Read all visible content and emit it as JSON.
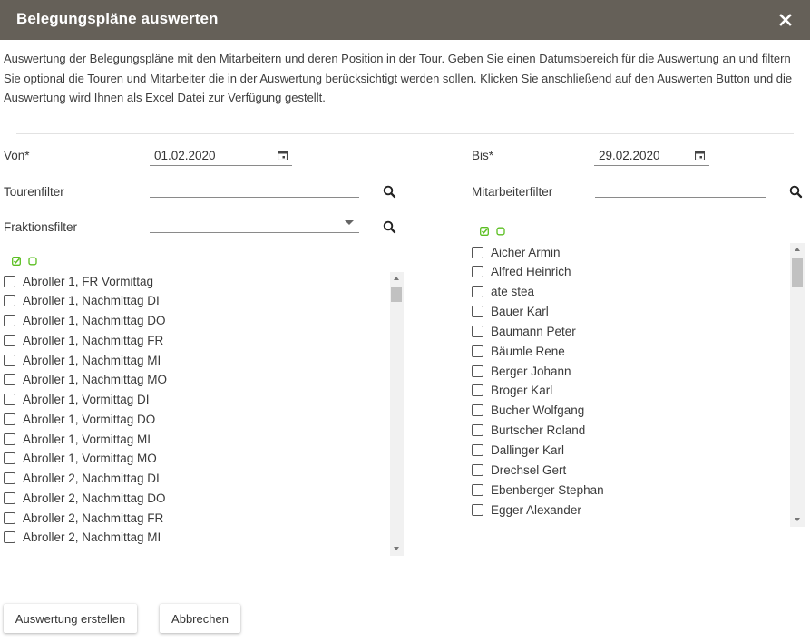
{
  "dialog": {
    "title": "Belegungspläne auswerten",
    "close_symbol": "✕",
    "intro": "Auswertung der Belegungspläne mit den Mitarbeitern und deren Position in der Tour. Geben Sie einen Datumsbereich für die Auswertung an und filtern Sie optional die Touren und Mitarbeiter die in der Auswertung berücksichtigt werden sollen. Klicken Sie anschließend auf den Auswerten Button und die Auswertung wird Ihnen als Excel Datei zur Verfügung gestellt."
  },
  "form": {
    "von_label": "Von*",
    "von_value": "01.02.2020",
    "bis_label": "Bis*",
    "bis_value": "29.02.2020",
    "tourenfilter_label": "Tourenfilter",
    "tourenfilter_value": "",
    "mitarbeiterfilter_label": "Mitarbeiterfilter",
    "mitarbeiterfilter_value": "",
    "fraktionsfilter_label": "Fraktionsfilter",
    "fraktionsfilter_value": ""
  },
  "touren_list": [
    "Abroller 1, FR Vormittag",
    "Abroller 1, Nachmittag DI",
    "Abroller 1, Nachmittag DO",
    "Abroller 1, Nachmittag FR",
    "Abroller 1, Nachmittag MI",
    "Abroller 1, Nachmittag MO",
    "Abroller 1, Vormittag DI",
    "Abroller 1, Vormittag DO",
    "Abroller 1, Vormittag MI",
    "Abroller 1, Vormittag MO",
    "Abroller 2, Nachmittag DI",
    "Abroller 2, Nachmittag DO",
    "Abroller 2, Nachmittag FR",
    "Abroller 2, Nachmittag MI"
  ],
  "mitarbeiter_list": [
    "Aicher Armin",
    "Alfred Heinrich",
    "ate stea",
    "Bauer Karl",
    "Baumann Peter",
    "Bäumle Rene",
    "Berger Johann",
    "Broger Karl",
    "Bucher Wolfgang",
    "Burtscher Roland",
    "Dallinger Karl",
    "Drechsel Gert",
    "Ebenberger Stephan",
    "Egger Alexander"
  ],
  "buttons": {
    "create": "Auswertung erstellen",
    "cancel": "Abbrechen"
  },
  "colors": {
    "titlebar": "#656058",
    "select_icons": "#5bbf21"
  }
}
